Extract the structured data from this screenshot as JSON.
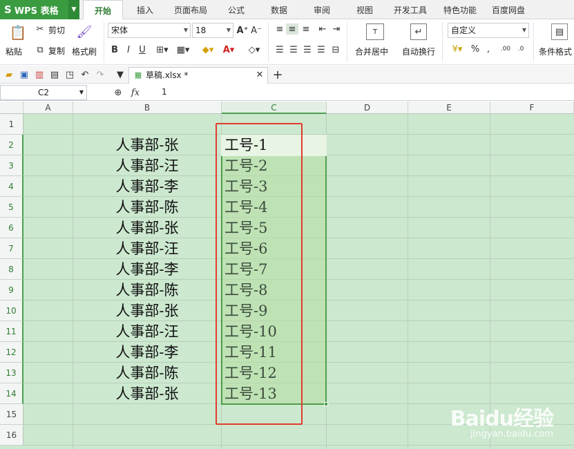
{
  "app": {
    "name": "WPS 表格"
  },
  "tabs": [
    "开始",
    "插入",
    "页面布局",
    "公式",
    "数据",
    "审阅",
    "视图",
    "开发工具",
    "特色功能",
    "百度网盘"
  ],
  "ribbon": {
    "paste": "粘贴",
    "cut": "剪切",
    "copy": "复制",
    "format_painter": "格式刷",
    "font_name": "宋体",
    "font_size": "18",
    "merge_center": "合并居中",
    "wrap_text": "自动换行",
    "number_format": "自定义",
    "conditional_format": "条件格式"
  },
  "document": {
    "tab_label": "草稿.xlsx *"
  },
  "formula_bar": {
    "name_box": "C2",
    "fx": "fx",
    "value": "1"
  },
  "columns": [
    "A",
    "B",
    "C",
    "D",
    "E",
    "F"
  ],
  "rows": [
    "1",
    "2",
    "3",
    "4",
    "5",
    "6",
    "7",
    "8",
    "9",
    "10",
    "11",
    "12",
    "13",
    "14",
    "15",
    "16"
  ],
  "cells": {
    "B": [
      "人事部-张",
      "人事部-汪",
      "人事部-李",
      "人事部-陈",
      "人事部-张",
      "人事部-汪",
      "人事部-李",
      "人事部-陈",
      "人事部-张",
      "人事部-汪",
      "人事部-李",
      "人事部-陈",
      "人事部-张"
    ],
    "C": [
      "工号-1",
      "工号-2",
      "工号-3",
      "工号-4",
      "工号-5",
      "工号-6",
      "工号-7",
      "工号-8",
      "工号-9",
      "工号-10",
      "工号-11",
      "工号-12",
      "工号-13"
    ]
  },
  "watermark": {
    "logo": "Baidu经验",
    "url": "jingyan.baidu.com"
  },
  "colors": {
    "accent": "#3a9b40",
    "grid_bg": "#cce8cf",
    "selection_border": "#4e9e4a",
    "annotation": "#e23a2e"
  }
}
